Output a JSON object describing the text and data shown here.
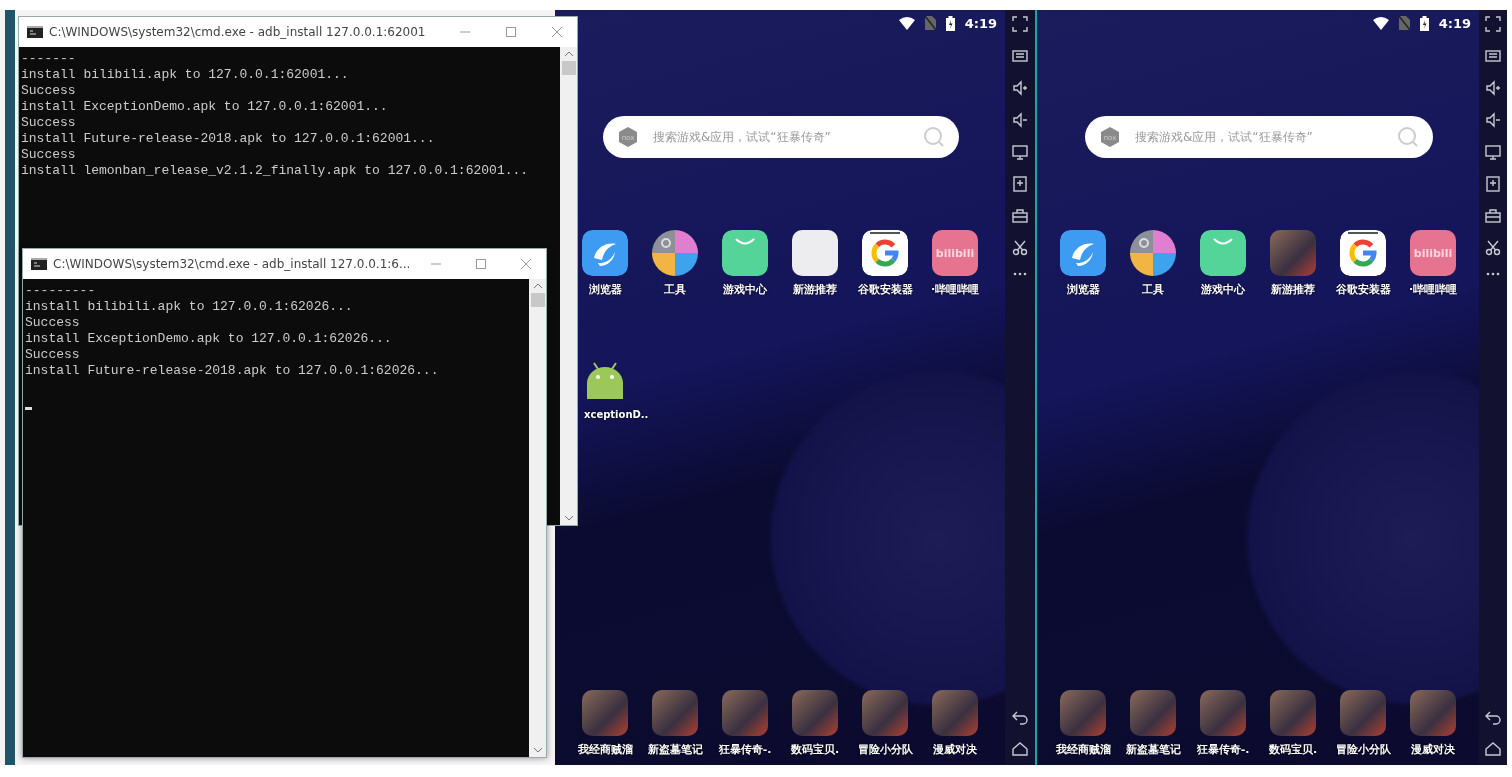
{
  "desktop": {
    "windows": [
      {
        "title": "C:\\WINDOWS\\system32\\cmd.exe - adb_install   127.0.0.1:62001",
        "cursor_visible": false,
        "lines": [
          "-------",
          "install bilibili.apk to 127.0.0.1:62001...",
          "Success",
          "install ExceptionDemo.apk to 127.0.0.1:62001...",
          "Success",
          "install Future-release-2018.apk to 127.0.0.1:62001...",
          "Success",
          "install lemonban_release_v2.1.2_finally.apk to 127.0.0.1:62001..."
        ]
      },
      {
        "title": "C:\\WINDOWS\\system32\\cmd.exe - adb_install   127.0.0.1:6...",
        "cursor_visible": true,
        "lines": [
          "---------",
          "install bilibili.apk to 127.0.0.1:62026...",
          "Success",
          "install ExceptionDemo.apk to 127.0.0.1:62026...",
          "Success",
          "install Future-release-2018.apk to 127.0.0.1:62026..."
        ]
      }
    ]
  },
  "emulators": [
    {
      "status": {
        "time": "4:19"
      },
      "search": {
        "logo": "nox",
        "placeholder": "搜索游戏&应用，试试“狂暴传奇”"
      },
      "apps": [
        {
          "label": "浏览器",
          "kind": "browser"
        },
        {
          "label": "工具",
          "kind": "tools"
        },
        {
          "label": "游戏中心",
          "kind": "game-center"
        },
        {
          "label": "新游推荐",
          "kind": "nox"
        },
        {
          "label": "谷歌安装器",
          "kind": "google"
        },
        {
          "label": "·哔哩哔哩",
          "kind": "bilibili",
          "icon_text": "bilibili"
        }
      ],
      "desktop_apps": [
        {
          "label": "xceptionD..",
          "kind": "android"
        }
      ],
      "dock": [
        {
          "label": "我经商贼溜",
          "kind": "photo"
        },
        {
          "label": "新盗墓笔记",
          "kind": "photo"
        },
        {
          "label": "狂暴传奇-.",
          "kind": "photo"
        },
        {
          "label": "数码宝贝.",
          "kind": "photo"
        },
        {
          "label": "冒险小分队",
          "kind": "photo"
        },
        {
          "label": "漫威对决",
          "kind": "photo"
        }
      ]
    },
    {
      "status": {
        "time": "4:19"
      },
      "search": {
        "logo": "nox",
        "placeholder": "搜索游戏&应用，试试“狂暴传奇”"
      },
      "apps": [
        {
          "label": "浏览器",
          "kind": "browser"
        },
        {
          "label": "工具",
          "kind": "tools"
        },
        {
          "label": "游戏中心",
          "kind": "game-center"
        },
        {
          "label": "新游推荐",
          "kind": "photo"
        },
        {
          "label": "谷歌安装器",
          "kind": "google"
        },
        {
          "label": "·哔哩哔哩",
          "kind": "bilibili",
          "icon_text": "bilibili"
        }
      ],
      "dock": [
        {
          "label": "我经商贼溜",
          "kind": "photo"
        },
        {
          "label": "新盗墓笔记",
          "kind": "photo"
        },
        {
          "label": "狂暴传奇-.",
          "kind": "photo"
        },
        {
          "label": "数码宝贝.",
          "kind": "photo"
        },
        {
          "label": "冒险小分队",
          "kind": "photo"
        },
        {
          "label": "漫威对决",
          "kind": "photo"
        }
      ]
    }
  ]
}
